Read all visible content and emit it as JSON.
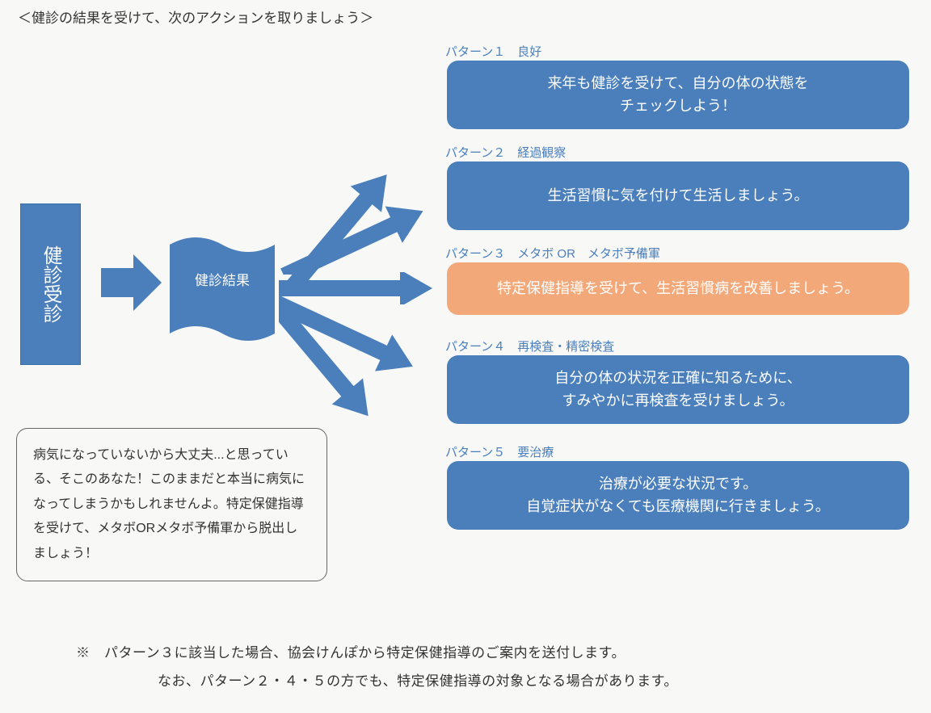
{
  "page_title": "＜健診の結果を受けて、次のアクションを取りましょう＞",
  "left_label": "健診受診",
  "result_label": "健診結果",
  "patterns": [
    {
      "label": "パターン１　良好",
      "body": "来年も健診を受けて、自分の体の状態を\nチェックしよう！"
    },
    {
      "label": "パターン２　経過観察",
      "body": "生活習慣に気を付けて生活しましょう。"
    },
    {
      "label": "パターン３　メタボ  OR　メタボ予備軍",
      "body": "特定保健指導を受けて、生活習慣病を改善しましょう。"
    },
    {
      "label": "パターン４　再検査・精密検査",
      "body": "自分の体の状況を正確に知るために、\nすみやかに再検査を受けましょう。"
    },
    {
      "label": "パターン５　要治療",
      "body": "治療が必要な状況です。\n自覚症状がなくても医療機関に行きましょう。"
    }
  ],
  "note_text": "病気になっていないから大丈夫...と思っている、そこのあなた！このままだと本当に病気になってしまうかもしれませんよ。特定保健指導を受けて、メタボORメタボ予備軍から脱出しましょう！",
  "footer1": "※　パターン３に該当した場合、協会けんぽから特定保健指導のご案内を送付します。",
  "footer2": "　　なお、パターン２・４・５の方でも、特定保健指導の対象となる場合があります。"
}
